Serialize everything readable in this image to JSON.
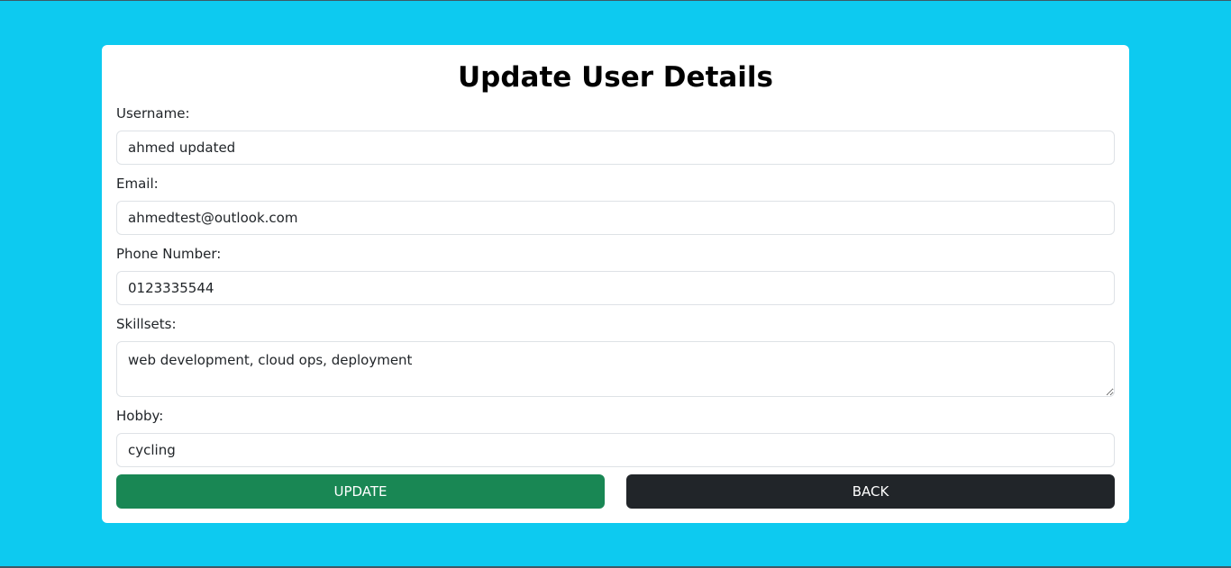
{
  "page": {
    "title": "Update User Details"
  },
  "form": {
    "username": {
      "label": "Username:",
      "value": "ahmed updated"
    },
    "email": {
      "label": "Email:",
      "value": "ahmedtest@outlook.com"
    },
    "phone": {
      "label": "Phone Number:",
      "value": "0123335544"
    },
    "skillsets": {
      "label": "Skillsets:",
      "value": "web development, cloud ops, deployment"
    },
    "hobby": {
      "label": "Hobby:",
      "value": "cycling"
    }
  },
  "actions": {
    "update_label": "UPDATE",
    "back_label": "BACK"
  },
  "colors": {
    "background": "#0dcaf0",
    "update_button": "#198754",
    "back_button": "#212529"
  }
}
